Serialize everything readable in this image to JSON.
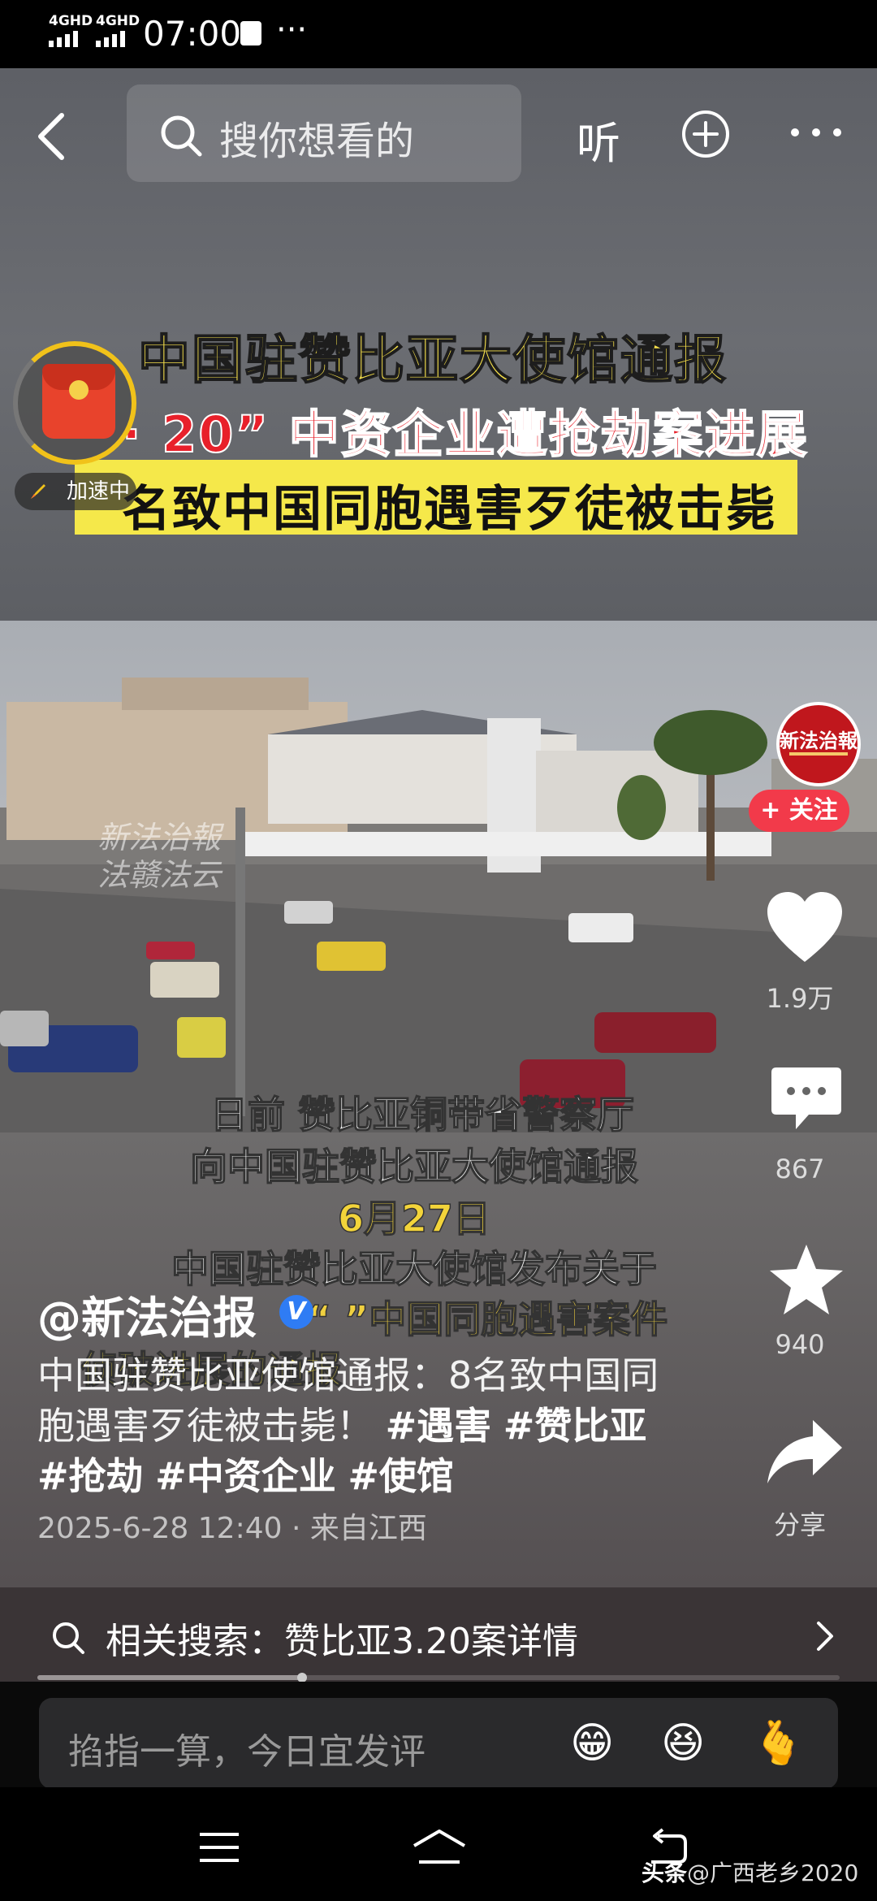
{
  "status_bar": {
    "network_1": "4GHD",
    "network_2": "4GHD",
    "time": "07:00",
    "overflow": "···"
  },
  "top_nav": {
    "search_placeholder": "搜你想看的",
    "listen_label": "听",
    "icons": [
      "back-icon",
      "search-icon",
      "add-icon",
      "more-icon"
    ]
  },
  "headline": {
    "line1": "中国驻赞比亚大使馆通报",
    "line2": "·  20” 中资企业遭抢劫案进展",
    "line3": "名致中国同胞遇害歹徒被击毙"
  },
  "red_packet": {
    "label": "加速中"
  },
  "watermark": {
    "line1": "新法治報",
    "line2": "法赣法云"
  },
  "subtitles": {
    "s1": "日前 赞比亚铜带省警察厅",
    "s2": "向中国驻赞比亚大使馆通报",
    "s3": "6月27日",
    "s4": "中国驻赞比亚大使馆发布关于",
    "s5": "“ ”中国同胞遇害案件",
    "s6": "侦破进展的通报"
  },
  "side_rail": {
    "avatar_text": "新法治報",
    "follow_label": "+ 关注",
    "like_count": "1.9万",
    "comment_count": "867",
    "favorite_count": "940",
    "share_label": "分享"
  },
  "caption": {
    "author": "@新法治报",
    "verified": "V",
    "text": "中国驻赞比亚使馆通报：8名致中国同胞遇害歹徒被击毙！",
    "tags": [
      "#遇害",
      "#赞比亚",
      "#抢劫",
      "#中资企业",
      "#使馆"
    ],
    "date": "2025-6-28 12:40",
    "source": "来自江西"
  },
  "related_search": {
    "label": "相关搜索：赞比亚3.20案详情"
  },
  "playback": {
    "progress": 0.33
  },
  "comment_bar": {
    "placeholder": "掐指一算，今日宜发评",
    "emojis": [
      "😁",
      "😆",
      "🫰"
    ]
  },
  "credit": {
    "brand": "头条",
    "handle": "@广西老乡2020"
  },
  "colors": {
    "follow": "#f23a4a",
    "headline_yellow": "#f7e14b",
    "headline_red": "#e8202a",
    "verified_blue": "#2f7cf4"
  }
}
